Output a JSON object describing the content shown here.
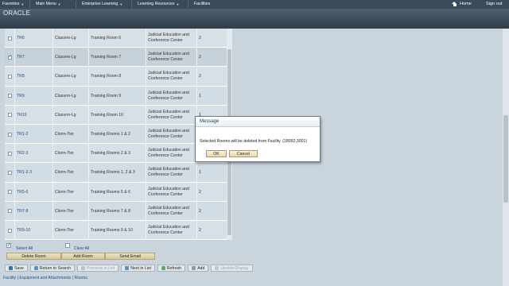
{
  "nav": {
    "favorites": "Favorites",
    "main_menu": "Main Menu",
    "enterprise_learning": "Enterprise Learning",
    "learning_resources": "Learning Resources",
    "facilities": "Facilities",
    "home": "Home",
    "sign_out": "Sign out"
  },
  "brand": {
    "logo": "ORACLE"
  },
  "grid": {
    "rows": [
      {
        "code": "TR6",
        "type": "Classrm-Lg",
        "name": "Training Room 6",
        "facility": "Judicial Education and Conference Center",
        "qty": "2",
        "checked": false
      },
      {
        "code": "TR7",
        "type": "Classrm-Lg",
        "name": "Training Room 7",
        "facility": "Judicial Education and Conference Center",
        "qty": "2",
        "checked": true
      },
      {
        "code": "TR8",
        "type": "Classrm-Lg",
        "name": "Training Room 8",
        "facility": "Judicial Education and Conference Center",
        "qty": "2",
        "checked": false
      },
      {
        "code": "TR9",
        "type": "Classrm-Lg",
        "name": "Training Room 9",
        "facility": "Judicial Education and Conference Center",
        "qty": "1",
        "checked": false
      },
      {
        "code": "TR10",
        "type": "Classrm-Lg",
        "name": "Training Room 10",
        "facility": "Judicial Education and Conference Center",
        "qty": "1",
        "checked": false
      },
      {
        "code": "TR1-2",
        "type": "Clsrm-Tier",
        "name": "Training Rooms 1 & 2",
        "facility": "Judicial Education and Conference Center",
        "qty": "2",
        "checked": false
      },
      {
        "code": "TR2-3",
        "type": "Clsrm-Tier",
        "name": "Training Rooms 2 & 3",
        "facility": "Judicial Education and Conference Center",
        "qty": "2",
        "checked": false
      },
      {
        "code": "TR1-2-3",
        "type": "Clsrm-Tier",
        "name": "Training Rooms 1, 2 & 3",
        "facility": "Judicial Education and Conference Center",
        "qty": "1",
        "checked": false
      },
      {
        "code": "TR5-6",
        "type": "Clsrm-Tier",
        "name": "Training Rooms 5 & 6",
        "facility": "Judicial Education and Conference Center",
        "qty": "2",
        "checked": false
      },
      {
        "code": "TR7-8",
        "type": "Clsrm-Tier",
        "name": "Training Rooms 7 & 8",
        "facility": "Judicial Education and Conference Center",
        "qty": "2",
        "checked": false
      },
      {
        "code": "TR9-10",
        "type": "Clsrm-Tier",
        "name": "Training Rooms 9 & 10",
        "facility": "Judicial Education and Conference Center",
        "qty": "2",
        "checked": false
      }
    ]
  },
  "selection": {
    "select_all": "Select All",
    "clear_all": "Clear All"
  },
  "actions": {
    "delete_room": "Delete Room",
    "add_room": "Add Room",
    "send_email": "Send Email"
  },
  "toolbar": {
    "save": "Save",
    "return_to_search": "Return to Search",
    "previous_in_list": "Previous in List",
    "next_in_list": "Next in List",
    "refresh": "Refresh",
    "add": "Add",
    "update_display": "Update/Display"
  },
  "breadcrumb": "Facility | Equipment and Attachments | Rooms",
  "modal": {
    "title": "Message",
    "message": "Selected Rooms will be deleted from Facility. (18092,3001)",
    "ok": "OK",
    "cancel": "Cancel"
  }
}
